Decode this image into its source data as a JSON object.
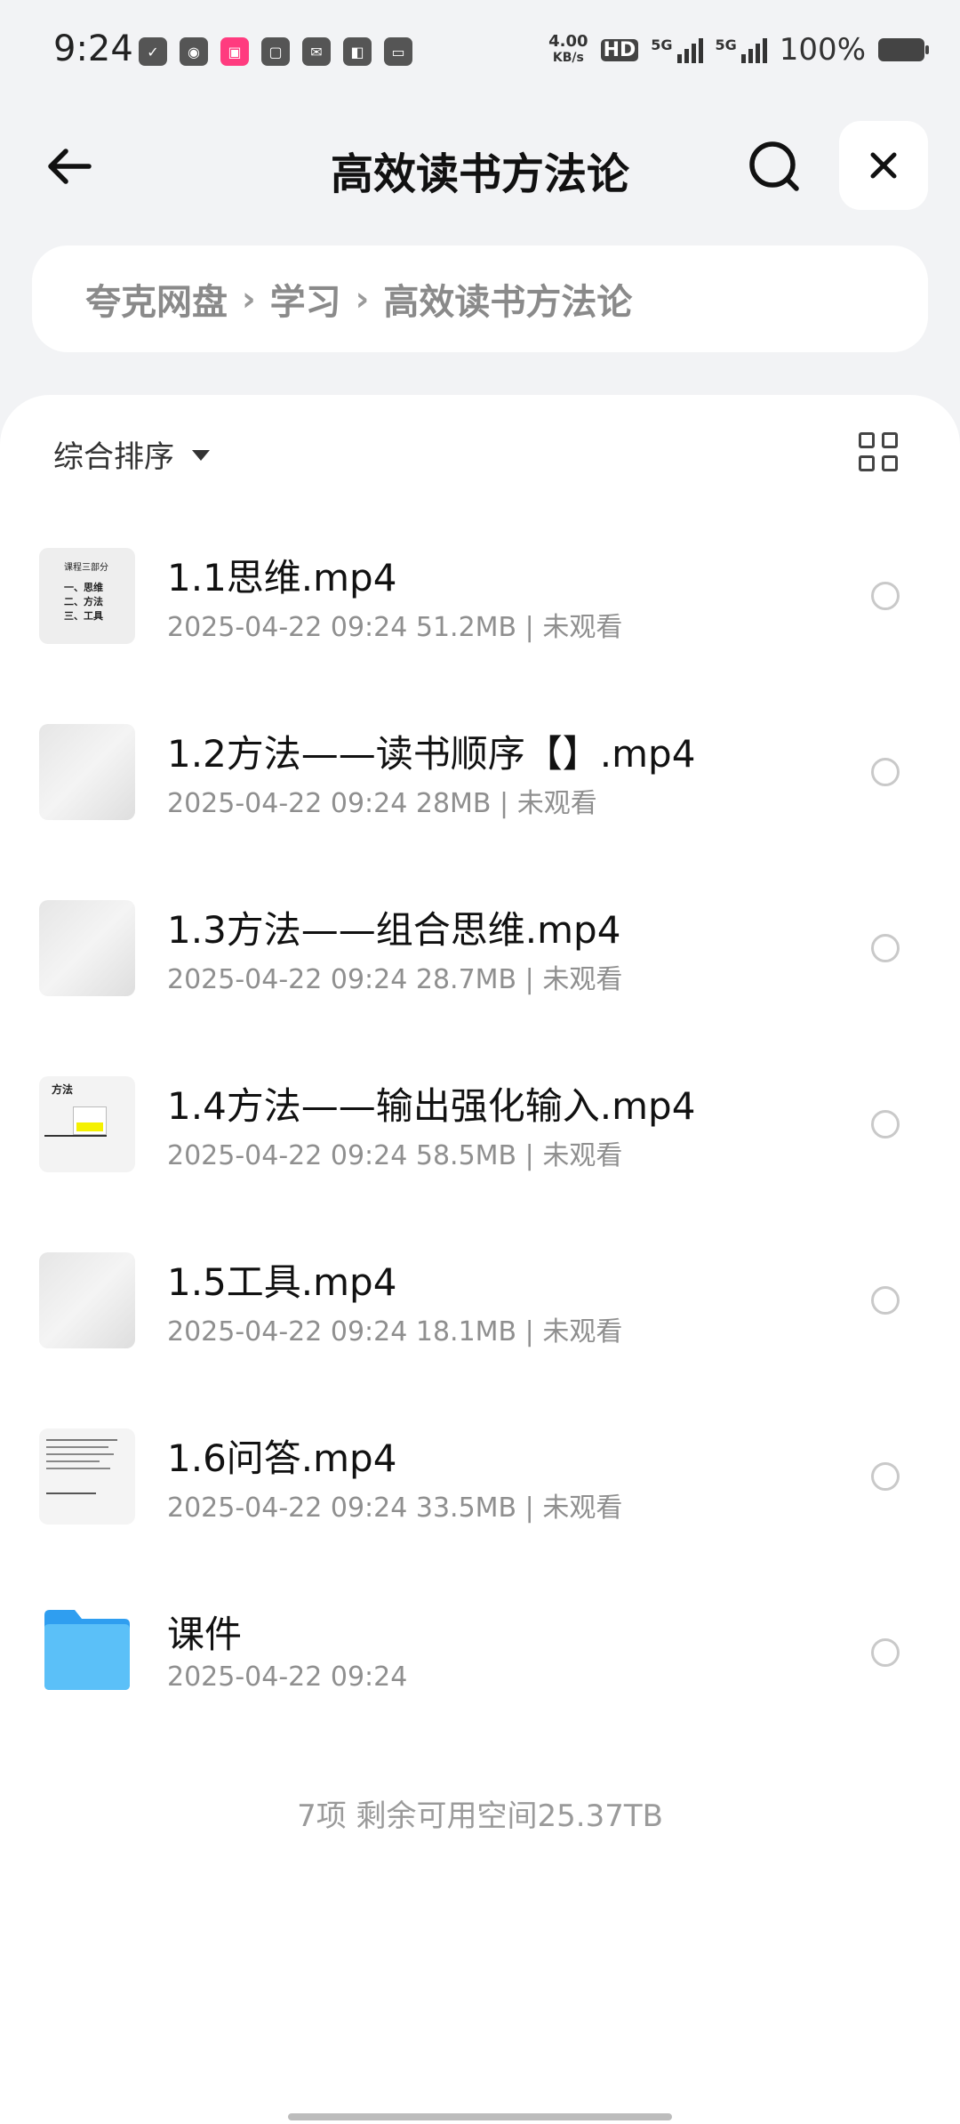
{
  "status_bar": {
    "time": "9:24",
    "net_speed_value": "4.00",
    "net_speed_unit": "KB/s",
    "hd_label": "HD",
    "network1": "5G",
    "network2": "5G",
    "battery": "100%",
    "app_icons": [
      "check-icon",
      "weibo-icon",
      "bilibili-icon",
      "tuan-icon",
      "mail-icon",
      "tie-icon",
      "vivo-icon"
    ]
  },
  "header": {
    "title": "高效读书方法论"
  },
  "breadcrumb": {
    "items": [
      "夸克网盘",
      "学习",
      "高效读书方法论"
    ],
    "separator": "›"
  },
  "toolbar": {
    "sort_label": "综合排序"
  },
  "files": [
    {
      "name": "1.1思维.mp4",
      "date": "2025-04-22 09:24",
      "size": "51.2MB",
      "status": "未观看",
      "meta": "2025-04-22 09:24  51.2MB | 未观看"
    },
    {
      "name": "1.2方法——读书顺序【】.mp4",
      "date": "2025-04-22 09:24",
      "size": "28MB",
      "status": "未观看",
      "meta": "2025-04-22 09:24  28MB | 未观看"
    },
    {
      "name": "1.3方法——组合思维.mp4",
      "date": "2025-04-22 09:24",
      "size": "28.7MB",
      "status": "未观看",
      "meta": "2025-04-22 09:24  28.7MB | 未观看"
    },
    {
      "name": "1.4方法——输出强化输入.mp4",
      "date": "2025-04-22 09:24",
      "size": "58.5MB",
      "status": "未观看",
      "meta": "2025-04-22 09:24  58.5MB | 未观看"
    },
    {
      "name": "1.5工具.mp4",
      "date": "2025-04-22 09:24",
      "size": "18.1MB",
      "status": "未观看",
      "meta": "2025-04-22 09:24  18.1MB | 未观看"
    },
    {
      "name": "1.6问答.mp4",
      "date": "2025-04-22 09:24",
      "size": "33.5MB",
      "status": "未观看",
      "meta": "2025-04-22 09:24  33.5MB | 未观看"
    },
    {
      "name": "课件",
      "date": "2025-04-22 09:24",
      "meta": "2025-04-22 09:24"
    }
  ],
  "thumb_text": {
    "t1_title": "课程三部分",
    "t1_l1": "一、思维",
    "t1_l2": "二、方法",
    "t1_l3": "三、工具",
    "t4_title": "方法"
  },
  "footer": {
    "summary": "7项 剩余可用空间25.37TB"
  },
  "colors": {
    "background": "#f2f3f5",
    "panel": "#ffffff",
    "folder": "#4fb4f5",
    "meta_text": "#8f8f8f"
  }
}
